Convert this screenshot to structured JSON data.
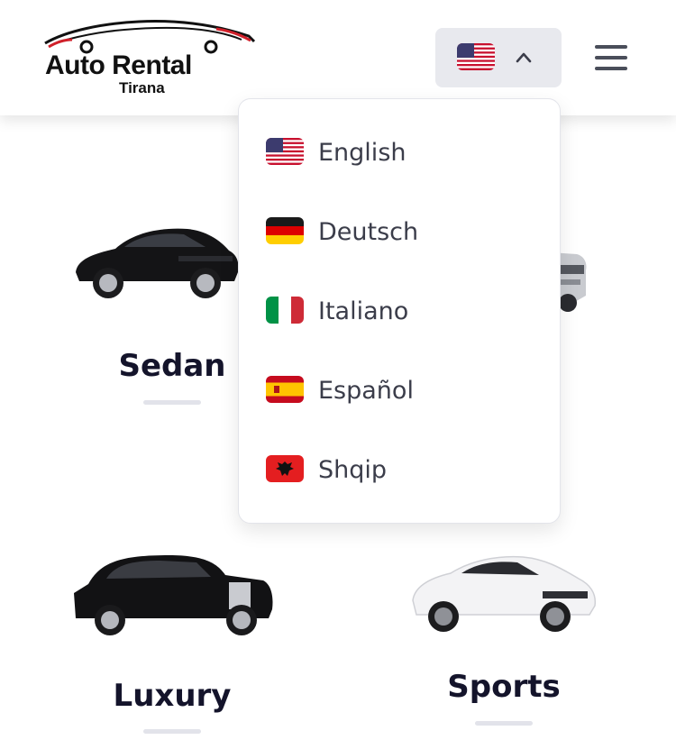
{
  "header": {
    "logo_title": "Auto Rental",
    "logo_subtitle": "Tirana",
    "language_toggle": {
      "flag": "us-flag-icon",
      "chevron": "chevron-up-icon"
    },
    "menu_icon": "hamburger-menu-icon"
  },
  "language_dropdown": {
    "items": [
      {
        "label": "English",
        "flag": "us-flag-icon"
      },
      {
        "label": "Deutsch",
        "flag": "germany-flag-icon"
      },
      {
        "label": "Italiano",
        "flag": "italy-flag-icon"
      },
      {
        "label": "Español",
        "flag": "spain-flag-icon"
      },
      {
        "label": "Shqip",
        "flag": "albania-flag-icon"
      }
    ]
  },
  "categories": [
    {
      "label": "Sedan",
      "image": "black-sedan-car"
    },
    {
      "label": "",
      "image": "silver-suv-car"
    },
    {
      "label": "Luxury",
      "image": "black-luxury-car"
    },
    {
      "label": "Sports",
      "image": "white-sports-car"
    }
  ],
  "colors": {
    "toggle_bg": "#e8e9ee",
    "text_dark": "#14142b",
    "dropdown_text": "#3b3d4a",
    "logo_accent": "#d0202a"
  }
}
